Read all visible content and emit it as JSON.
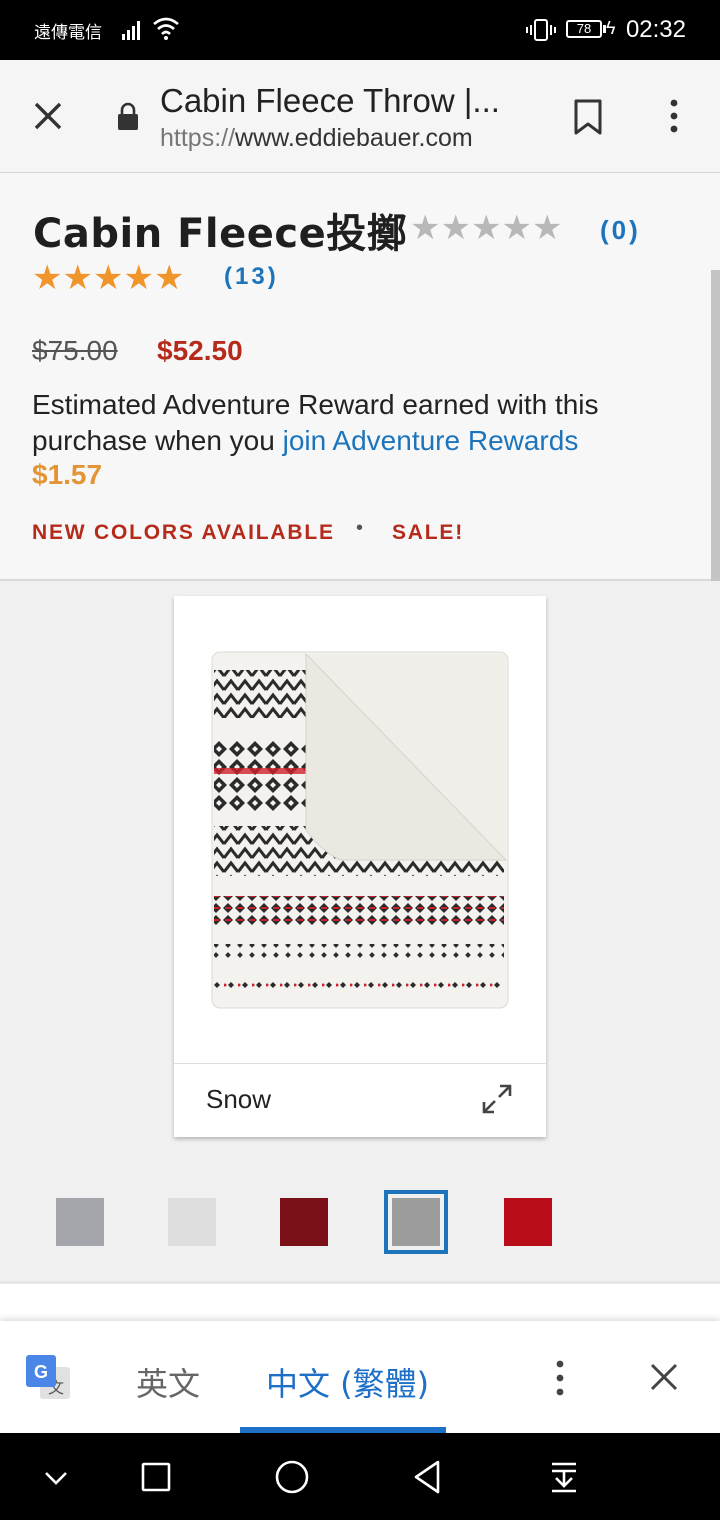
{
  "status_bar": {
    "carrier": "遠傳電信",
    "battery": "78",
    "time": "02:32"
  },
  "toolbar": {
    "title": "Cabin Fleece Throw |...",
    "url_scheme": "https://",
    "url_host": "www.eddiebauer.com"
  },
  "product": {
    "title": "Cabin Fleece投擲",
    "review_count_translated": "(0)",
    "rating": 5,
    "review_count": "(13)",
    "original_price": "$75.00",
    "sale_price": "$52.50",
    "reward_text": "Estimated Adventure Reward earned with this purchase when you ",
    "reward_link": "join Adventure Rewards",
    "reward_amount": "$1.57",
    "badges": [
      "NEW COLORS AVAILABLE",
      "SALE!"
    ],
    "badge_separator": "•"
  },
  "gallery": {
    "color_name": "Snow",
    "swatches": [
      {
        "name": "grey",
        "color": "#a4a6ab"
      },
      {
        "name": "white-grey",
        "color": "#dedede"
      },
      {
        "name": "red-black-plaid",
        "color": "#7a1018"
      },
      {
        "name": "fair-isle-selected",
        "color": "#9c9c9c"
      },
      {
        "name": "red",
        "color": "#b80d18"
      }
    ]
  },
  "translate_bar": {
    "source_lang": "英文",
    "target_lang": "中文 (繁體)"
  },
  "colors": {
    "accent": "#1d74bb",
    "sale_red": "#b52b1b",
    "star_orange": "#f0942c",
    "reward_orange": "#e39536"
  }
}
